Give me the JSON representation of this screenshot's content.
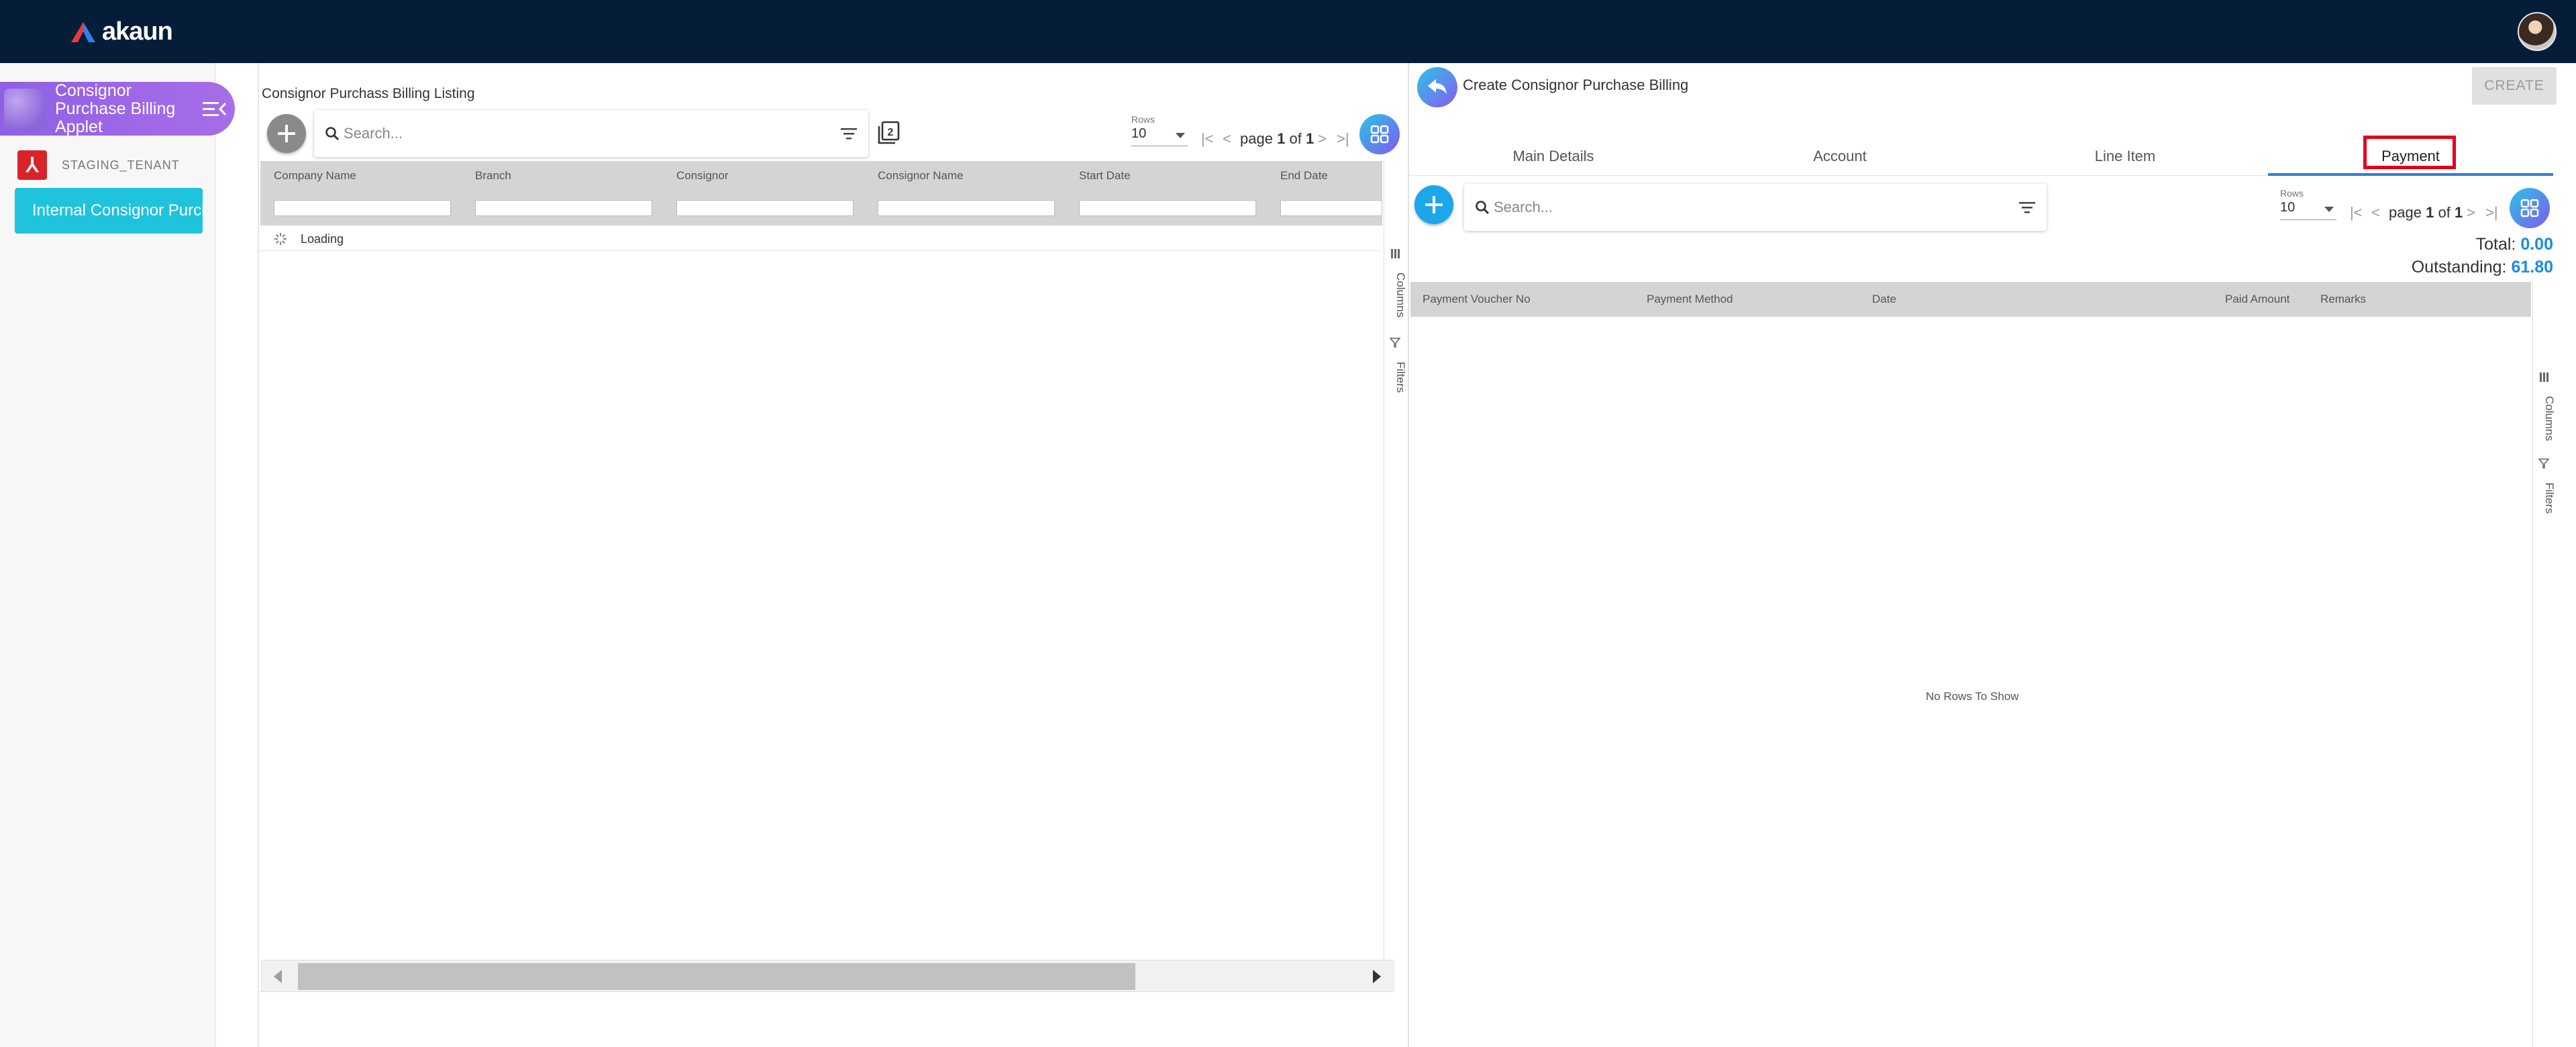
{
  "app": {
    "brand": "akaun"
  },
  "sidebar": {
    "applet_title": "Consignor Purchase Billing Applet",
    "tenant": "STAGING_TENANT",
    "nav_item": "Internal Consignor Purchase Billing"
  },
  "listing": {
    "title": "Consignor Purchass Billing Listing",
    "search_placeholder": "Search...",
    "rows_label": "Rows",
    "rows_value": "10",
    "page_word": "page",
    "page_current": "1",
    "page_of": "of",
    "page_total": "1",
    "columns": [
      "Company Name",
      "Branch",
      "Consignor",
      "Consignor Name",
      "Start Date",
      "End Date"
    ],
    "side_tools": [
      "Columns",
      "Filters"
    ],
    "loading_text": "Loading"
  },
  "create": {
    "title": "Create Consignor Purchase Billing",
    "create_label": "CREATE",
    "tabs": [
      "Main Details",
      "Account",
      "Line Item",
      "Payment"
    ],
    "active_tab": "Payment",
    "search_placeholder": "Search...",
    "rows_label": "Rows",
    "rows_value": "10",
    "page_word": "page",
    "page_current": "1",
    "page_of": "of",
    "page_total": "1",
    "total_label": "Total:",
    "total_value": "0.00",
    "outstanding_label": "Outstanding:",
    "outstanding_value": "61.80",
    "columns": [
      "Payment Voucher No",
      "Payment Method",
      "Date",
      "Paid Amount",
      "Remarks"
    ],
    "side_tools": [
      "Columns",
      "Filters"
    ],
    "empty_text": "No Rows To Show"
  },
  "colors": {
    "topbar": "#051d38",
    "accent": "#1d8ae3",
    "applet": "#9b67e8",
    "nav": "#1fc3dc",
    "highlight": "#e3001b"
  }
}
